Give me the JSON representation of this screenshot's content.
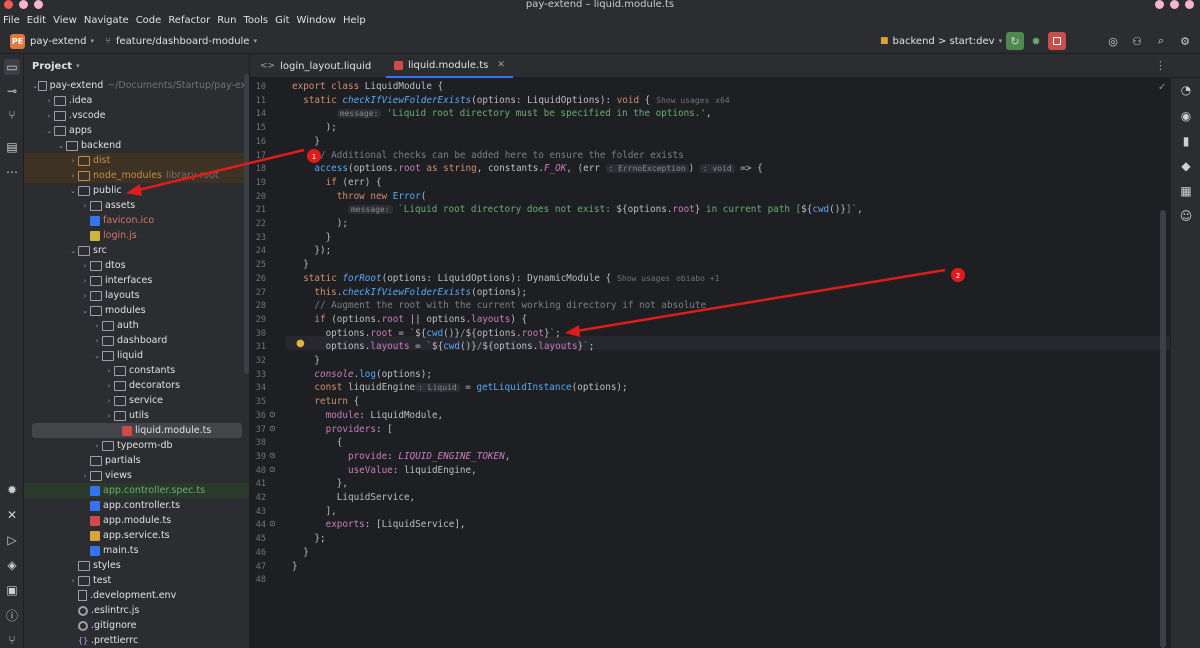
{
  "window": {
    "title": "pay-extend – liquid.module.ts"
  },
  "menu": [
    "File",
    "Edit",
    "View",
    "Navigate",
    "Code",
    "Refactor",
    "Run",
    "Tools",
    "Git",
    "Window",
    "Help"
  ],
  "toolbar": {
    "project_badge": "PE",
    "project_name": "pay-extend",
    "branch": "feature/dashboard-module",
    "run_config": "backend > start:dev"
  },
  "project_panel": {
    "title": "Project",
    "tree": [
      {
        "label": "pay-extend",
        "hint": "~/Documents/Startup/pay-ext",
        "depth": 0,
        "open": true,
        "kind": "folder"
      },
      {
        "label": ".idea",
        "depth": 1,
        "open": false,
        "kind": "folder"
      },
      {
        "label": ".vscode",
        "depth": 1,
        "open": false,
        "kind": "folder"
      },
      {
        "label": "apps",
        "depth": 1,
        "open": true,
        "kind": "folder"
      },
      {
        "label": "backend",
        "depth": 2,
        "open": true,
        "kind": "folder"
      },
      {
        "label": "dist",
        "depth": 3,
        "open": false,
        "kind": "folder-excluded"
      },
      {
        "label": "node_modules",
        "hint": "library root",
        "depth": 3,
        "open": false,
        "kind": "folder-excluded"
      },
      {
        "label": "public",
        "depth": 3,
        "open": true,
        "kind": "folder"
      },
      {
        "label": "assets",
        "depth": 4,
        "open": false,
        "kind": "folder"
      },
      {
        "label": "favicon.ico",
        "depth": 4,
        "kind": "file-ico"
      },
      {
        "label": "login.js",
        "depth": 4,
        "kind": "file-js"
      },
      {
        "label": "src",
        "depth": 3,
        "open": true,
        "kind": "folder"
      },
      {
        "label": "dtos",
        "depth": 4,
        "open": false,
        "kind": "folder"
      },
      {
        "label": "interfaces",
        "depth": 4,
        "open": false,
        "kind": "folder"
      },
      {
        "label": "layouts",
        "depth": 4,
        "open": false,
        "kind": "folder"
      },
      {
        "label": "modules",
        "depth": 4,
        "open": true,
        "kind": "folder"
      },
      {
        "label": "auth",
        "depth": 5,
        "open": false,
        "kind": "folder"
      },
      {
        "label": "dashboard",
        "depth": 5,
        "open": false,
        "kind": "folder"
      },
      {
        "label": "liquid",
        "depth": 5,
        "open": true,
        "kind": "folder"
      },
      {
        "label": "constants",
        "depth": 6,
        "open": false,
        "kind": "folder"
      },
      {
        "label": "decorators",
        "depth": 6,
        "open": false,
        "kind": "folder"
      },
      {
        "label": "service",
        "depth": 6,
        "open": false,
        "kind": "folder"
      },
      {
        "label": "utils",
        "depth": 6,
        "open": false,
        "kind": "folder"
      },
      {
        "label": "liquid.module.ts",
        "depth": 6,
        "kind": "file-module",
        "selected": true
      },
      {
        "label": "typeorm-db",
        "depth": 5,
        "open": false,
        "kind": "folder"
      },
      {
        "label": "partials",
        "depth": 4,
        "kind": "folder"
      },
      {
        "label": "views",
        "depth": 4,
        "open": false,
        "kind": "folder"
      },
      {
        "label": "app.controller.spec.ts",
        "depth": 4,
        "kind": "file-spec",
        "highlight": true
      },
      {
        "label": "app.controller.ts",
        "depth": 4,
        "kind": "file-ts"
      },
      {
        "label": "app.module.ts",
        "depth": 4,
        "kind": "file-module"
      },
      {
        "label": "app.service.ts",
        "depth": 4,
        "kind": "file-service"
      },
      {
        "label": "main.ts",
        "depth": 4,
        "kind": "file-ts"
      },
      {
        "label": "styles",
        "depth": 3,
        "kind": "folder"
      },
      {
        "label": "test",
        "depth": 3,
        "open": false,
        "kind": "folder"
      },
      {
        "label": ".development.env",
        "depth": 3,
        "kind": "file"
      },
      {
        "label": ".eslintrc.js",
        "depth": 3,
        "kind": "file-gear"
      },
      {
        "label": ".gitignore",
        "depth": 3,
        "kind": "file-git"
      },
      {
        "label": ".prettierrc",
        "depth": 3,
        "kind": "file-json"
      }
    ]
  },
  "tabs": [
    {
      "label": "login_layout.liquid",
      "active": false
    },
    {
      "label": "liquid.module.ts",
      "active": true
    }
  ],
  "editor": {
    "line_numbers": [
      "10",
      "11",
      "14",
      "15",
      "16",
      "17",
      "18",
      "19",
      "20",
      "21",
      "22",
      "23",
      "24",
      "25",
      "26",
      "27",
      "28",
      "29",
      "30",
      "31",
      "32",
      "33",
      "34",
      "35",
      "36",
      "37",
      "38",
      "39",
      "40",
      "41",
      "42",
      "43",
      "44",
      "45",
      "46",
      "47",
      "48"
    ],
    "usages_1": "Show usages",
    "usages_1_count": "x64",
    "usages_2": "Show usages",
    "usages_2_author": "obiabo +1",
    "hint_message": "message:",
    "hint_errno": "ErrnoException",
    "hint_void": "void",
    "hint_liquid": ": Liquid",
    "annotation_1": "1",
    "annotation_2": "2"
  }
}
